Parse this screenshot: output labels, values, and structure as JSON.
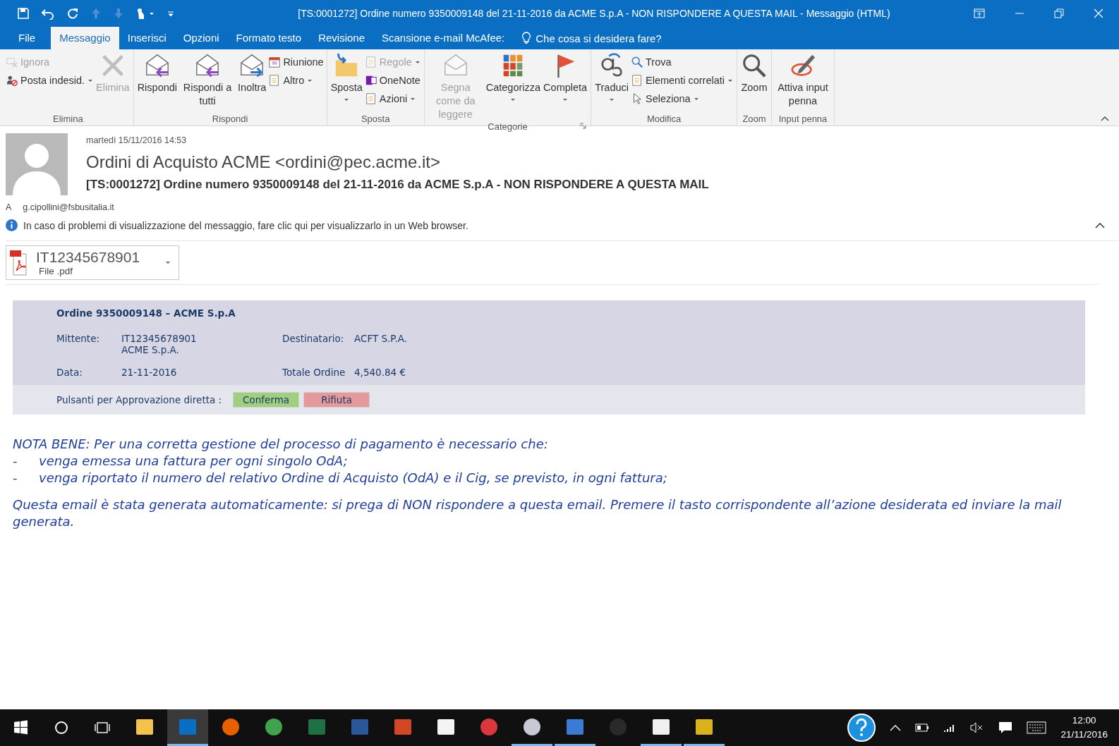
{
  "window": {
    "title": "[TS:0001272] Ordine numero 9350009148 del 21-11-2016 da ACME S.p.A - NON RISPONDERE A QUESTA MAIL - Messaggio (HTML)"
  },
  "tabs": [
    {
      "label": "File",
      "selected": false
    },
    {
      "label": "Messaggio",
      "selected": true
    },
    {
      "label": "Inserisci",
      "selected": false
    },
    {
      "label": "Opzioni",
      "selected": false
    },
    {
      "label": "Formato testo",
      "selected": false
    },
    {
      "label": "Revisione",
      "selected": false
    },
    {
      "label": "Scansione e-mail McAfee:",
      "selected": false
    }
  ],
  "tell_me": {
    "placeholder": "Che cosa si desidera fare?"
  },
  "ribbon": [
    {
      "label": "Elimina",
      "launcher": false,
      "columns": [
        {
          "kind": "stack",
          "buttons": [
            {
              "label": "Ignora",
              "disabled": true,
              "dropdown": false
            },
            {
              "label": "Posta indesid.",
              "disabled": false,
              "dropdown": true
            }
          ]
        },
        {
          "kind": "large",
          "buttons": [
            {
              "label": "Elimina",
              "disabled": true,
              "dropdown": false
            }
          ]
        }
      ]
    },
    {
      "label": "Rispondi",
      "launcher": false,
      "columns": [
        {
          "kind": "large",
          "buttons": [
            {
              "label": "Rispondi",
              "disabled": false,
              "dropdown": false
            }
          ]
        },
        {
          "kind": "large",
          "buttons": [
            {
              "label": "Rispondi a tutti",
              "disabled": false,
              "dropdown": false
            }
          ]
        },
        {
          "kind": "large",
          "buttons": [
            {
              "label": "Inoltra",
              "disabled": false,
              "dropdown": false
            }
          ]
        },
        {
          "kind": "stack",
          "buttons": [
            {
              "label": "Riunione",
              "disabled": false,
              "dropdown": false
            },
            {
              "label": "Altro",
              "disabled": false,
              "dropdown": true
            }
          ]
        }
      ]
    },
    {
      "label": "Sposta",
      "launcher": false,
      "columns": [
        {
          "kind": "large",
          "buttons": [
            {
              "label": "Sposta",
              "disabled": false,
              "dropdown": true
            }
          ]
        },
        {
          "kind": "stack",
          "buttons": [
            {
              "label": "Regole",
              "disabled": true,
              "dropdown": true
            },
            {
              "label": "OneNote",
              "disabled": false,
              "dropdown": false
            },
            {
              "label": "Azioni",
              "disabled": false,
              "dropdown": true
            }
          ]
        }
      ]
    },
    {
      "label": "Categorie",
      "launcher": true,
      "columns": [
        {
          "kind": "large",
          "buttons": [
            {
              "label": "Segna come da leggere",
              "disabled": true,
              "dropdown": false
            }
          ]
        },
        {
          "kind": "large",
          "buttons": [
            {
              "label": "Categorizza",
              "disabled": false,
              "dropdown": true
            }
          ]
        },
        {
          "kind": "large",
          "buttons": [
            {
              "label": "Completa",
              "disabled": false,
              "dropdown": true
            }
          ]
        }
      ]
    },
    {
      "label": "Modifica",
      "launcher": false,
      "columns": [
        {
          "kind": "large",
          "buttons": [
            {
              "label": "Traduci",
              "disabled": false,
              "dropdown": true
            }
          ]
        },
        {
          "kind": "stack",
          "buttons": [
            {
              "label": "Trova",
              "disabled": false,
              "dropdown": false
            },
            {
              "label": "Elementi correlati",
              "disabled": false,
              "dropdown": true
            },
            {
              "label": "Seleziona",
              "disabled": false,
              "dropdown": true
            }
          ]
        }
      ]
    },
    {
      "label": "Zoom",
      "launcher": false,
      "columns": [
        {
          "kind": "large",
          "buttons": [
            {
              "label": "Zoom",
              "disabled": false,
              "dropdown": false
            }
          ]
        }
      ]
    },
    {
      "label": "Input penna",
      "launcher": false,
      "columns": [
        {
          "kind": "large",
          "buttons": [
            {
              "label": "Attiva input penna",
              "disabled": false,
              "dropdown": false
            }
          ]
        }
      ]
    }
  ],
  "message": {
    "date": "martedì 15/11/2016 14:53",
    "sender": "Ordini di Acquisto ACME <ordini@pec.acme.it>",
    "subject": "[TS:0001272] Ordine numero 9350009148 del 21-11-2016 da ACME S.p.A - NON RISPONDERE A QUESTA MAIL",
    "to_label": "A",
    "to": "g.cipollini@fsbusitalia.it",
    "info": "In caso di problemi di visualizzazione del messaggio, fare clic qui per visualizzarlo in un Web browser.",
    "attachment": {
      "name": "IT12345678901",
      "type": "File .pdf"
    }
  },
  "order": {
    "title": "Ordine 9350009148 – ACME S.p.A",
    "fields": [
      {
        "label": "Mittente:",
        "lines": [
          "IT12345678901",
          "ACME S.p.A."
        ]
      },
      {
        "label": "Destinatario:",
        "lines": [
          "ACFT S.P.A."
        ]
      },
      {
        "label": "Data:",
        "lines": [
          "21-11-2016"
        ]
      },
      {
        "label": "Totale Ordine",
        "lines": [
          "4,540.84 €"
        ]
      }
    ],
    "actions_label": "Pulsanti per Approvazione diretta :",
    "actions": [
      {
        "label": "Conferma",
        "color": "#9fcf7f"
      },
      {
        "label": "Rifiuta",
        "color": "#e49a9a"
      }
    ]
  },
  "note": {
    "intro": "NOTA BENE: Per una corretta gestione del processo di pagamento è necessario che:",
    "items": [
      {
        "bullet": "-",
        "text": "venga emessa una fattura per ogni singolo OdA;"
      },
      {
        "bullet": "-",
        "text": "venga riportato il numero del relativo Ordine di Acquisto (OdA) e il Cig, se previsto, in ogni fattura;"
      }
    ],
    "closing": "Questa email è stata generata automaticamente: si prega di NON rispondere a questa email. Premere il tasto corrispondente all’azione desiderata ed inviare la mail generata."
  },
  "taskbar": {
    "apps": [
      {
        "color": "#f2c24b",
        "selected": false,
        "running": false
      },
      {
        "color": "#0a6fc2",
        "selected": true,
        "running": true
      },
      {
        "color": "#e66000",
        "selected": false,
        "running": false
      },
      {
        "color": "#3fa34d",
        "selected": false,
        "running": false
      },
      {
        "color": "#1e7145",
        "selected": false,
        "running": false
      },
      {
        "color": "#2b579a",
        "selected": false,
        "running": false
      },
      {
        "color": "#d24726",
        "selected": false,
        "running": false
      },
      {
        "color": "#f4f4f4",
        "selected": false,
        "running": false
      },
      {
        "color": "#d9393e",
        "selected": false,
        "running": false
      },
      {
        "color": "#c9c9d6",
        "selected": false,
        "running": true
      },
      {
        "color": "#3a7bd5",
        "selected": false,
        "running": true
      },
      {
        "color": "#2a2a2a",
        "selected": false,
        "running": false
      },
      {
        "color": "#f0f0f0",
        "selected": false,
        "running": true
      },
      {
        "color": "#d9b21e",
        "selected": false,
        "running": true
      }
    ],
    "time": "12:00",
    "date": "21/11/2016"
  }
}
